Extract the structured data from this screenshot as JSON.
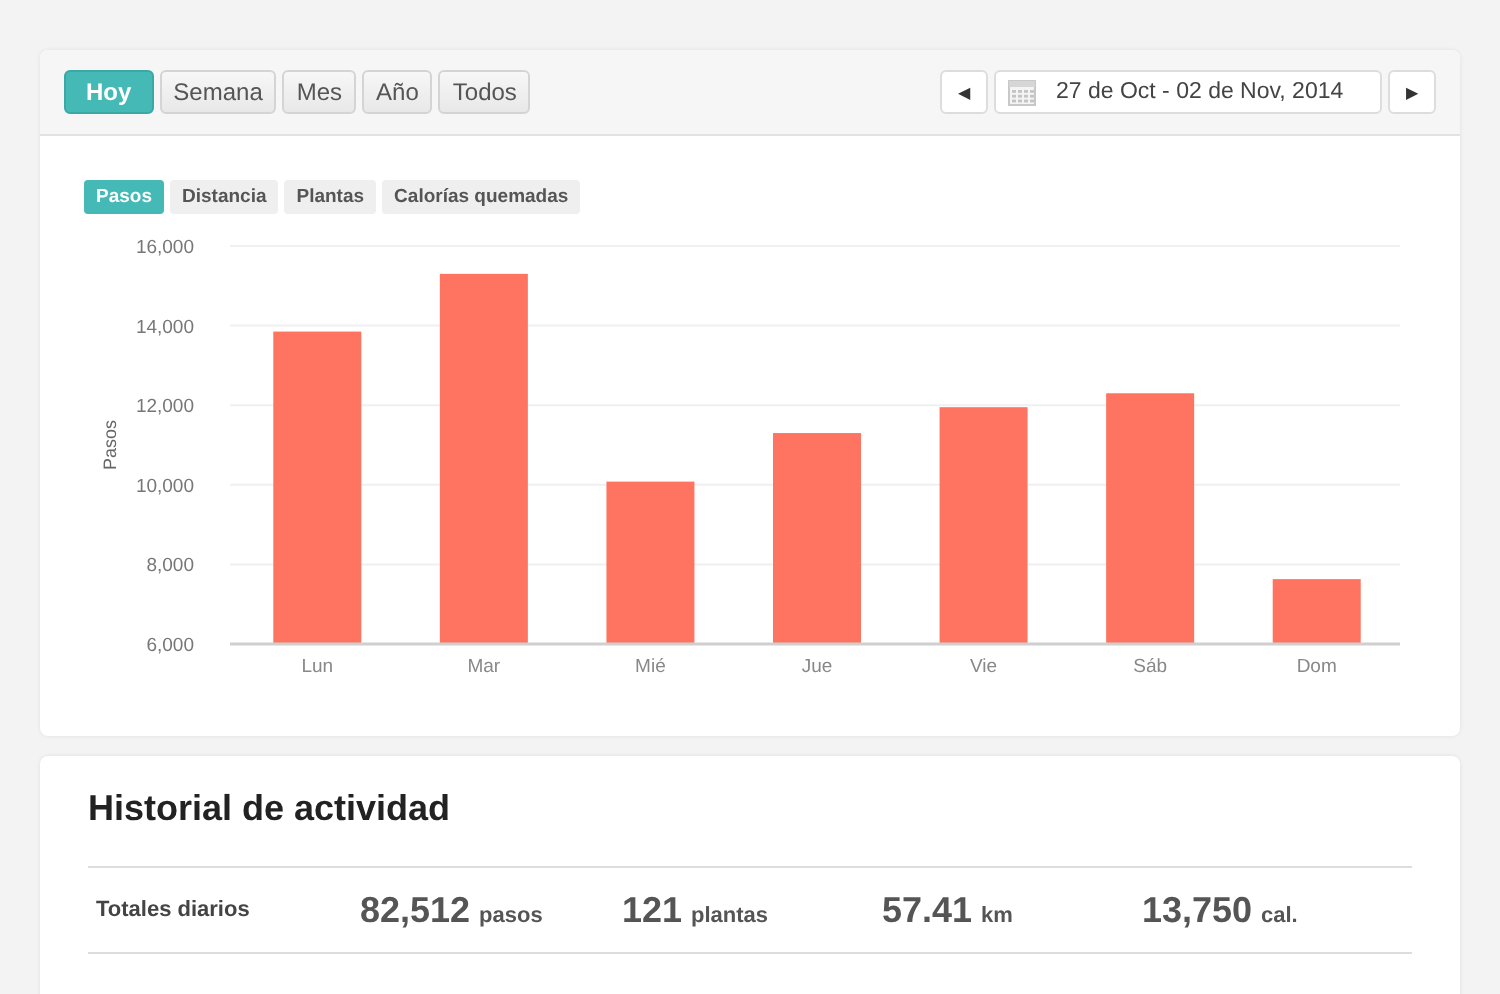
{
  "range_buttons": [
    {
      "label": "Hoy",
      "selected": true
    },
    {
      "label": "Semana",
      "selected": false
    },
    {
      "label": "Mes",
      "selected": false
    },
    {
      "label": "Año",
      "selected": false
    },
    {
      "label": "Todos",
      "selected": false
    }
  ],
  "date_range": {
    "prev": "◀",
    "value": "27 de Oct - 02 de Nov, 2014",
    "next": "▶"
  },
  "metric_tabs": [
    {
      "label": "Pasos",
      "selected": true
    },
    {
      "label": "Distancia",
      "selected": false
    },
    {
      "label": "Plantas",
      "selected": false
    },
    {
      "label": "Calorías quemadas",
      "selected": false
    }
  ],
  "chart_data": {
    "type": "bar",
    "ylabel": "Pasos",
    "categories": [
      "Lun",
      "Mar",
      "Mié",
      "Jue",
      "Vie",
      "Sáb",
      "Dom"
    ],
    "grid": true,
    "series": [
      {
        "color": "#ff7461",
        "values": [
          13850,
          15300,
          10080,
          11300,
          11950,
          12300,
          7630
        ]
      }
    ],
    "ylim": [
      6000,
      16000
    ],
    "yticks": [
      {
        "value": 6000,
        "label": "6,000"
      },
      {
        "value": 8000,
        "label": "8,000"
      },
      {
        "value": 10000,
        "label": "10,000"
      },
      {
        "value": 12000,
        "label": "12,000"
      },
      {
        "value": 14000,
        "label": "14,000"
      },
      {
        "value": 16000,
        "label": "16,000"
      }
    ]
  },
  "history": {
    "title": "Historial de actividad",
    "row_label": "Totales diarios",
    "totals": [
      {
        "value": "82,512",
        "unit": "pasos"
      },
      {
        "value": "121",
        "unit": "plantas"
      },
      {
        "value": "57.41",
        "unit": "km"
      },
      {
        "value": "13,750",
        "unit": "cal."
      }
    ]
  }
}
